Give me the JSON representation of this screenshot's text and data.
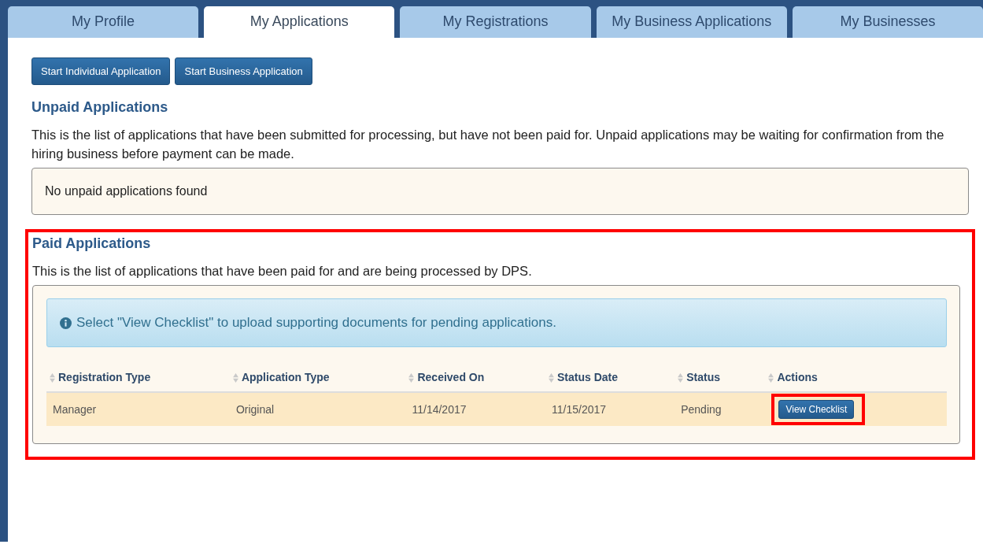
{
  "tabs": [
    {
      "label": "My Profile",
      "selected": false
    },
    {
      "label": "My Applications",
      "selected": true
    },
    {
      "label": "My Registrations",
      "selected": false
    },
    {
      "label": "My Business Applications",
      "selected": false
    },
    {
      "label": "My Businesses",
      "selected": false
    }
  ],
  "action_buttons": [
    "Start Individual Application",
    "Start Business Application"
  ],
  "unpaid": {
    "title": "Unpaid Applications",
    "description": "This is the list of applications that have been submitted for processing, but have not been paid for. Unpaid applications may be waiting for confirmation from the hiring business before payment can be made.",
    "empty_message": "No unpaid applications found",
    "highlighted": false
  },
  "paid": {
    "title": "Paid Applications",
    "description": "This is the list of applications that have been paid for and are being processed by DPS.",
    "highlighted": true,
    "alert": "Select \"View Checklist\" to upload supporting documents for pending applications.",
    "table": {
      "columns": [
        "Registration Type",
        "Application Type",
        "Received On",
        "Status Date",
        "Status",
        "Actions"
      ],
      "rows": [
        {
          "cells": [
            "Manager",
            "Original",
            "11/14/2017",
            "11/15/2017",
            "Pending"
          ],
          "action": {
            "label": "View Checklist",
            "highlighted": true
          }
        }
      ]
    }
  }
}
